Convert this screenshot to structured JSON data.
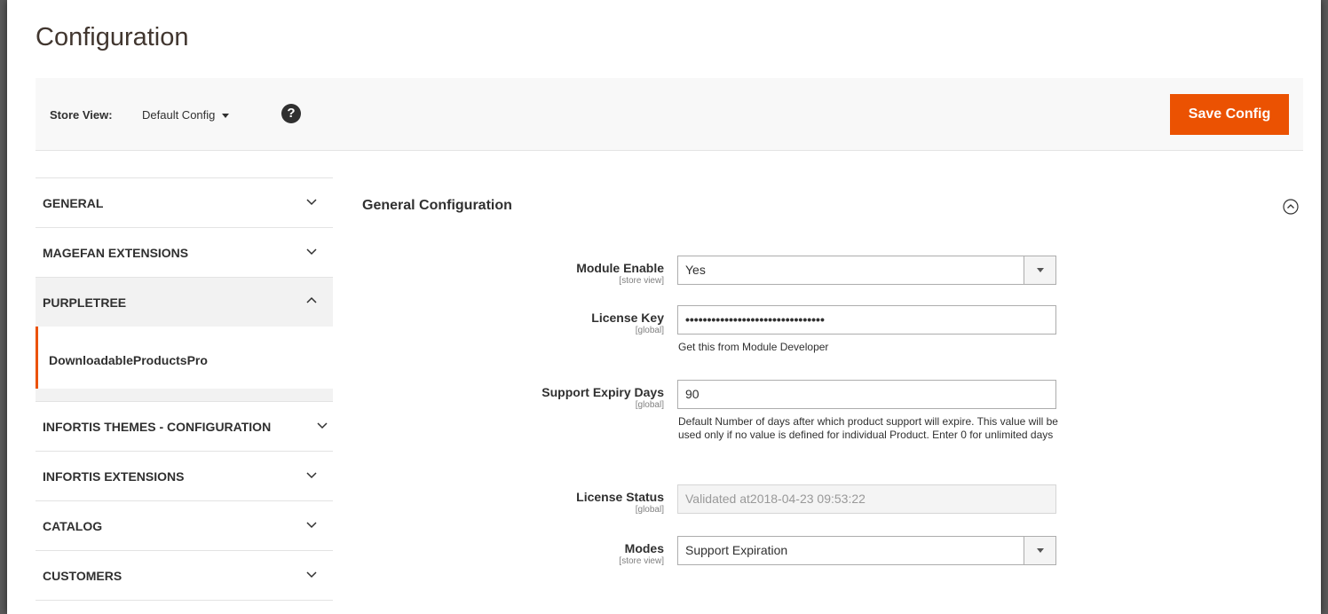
{
  "page": {
    "title": "Configuration"
  },
  "store_bar": {
    "label": "Store View:",
    "value": "Default Config",
    "help_glyph": "?",
    "save_label": "Save Config",
    "accent_color": "#eb5202"
  },
  "sidebar": {
    "tabs": [
      {
        "label": "GENERAL",
        "state": "collapsed",
        "icon": "chevron-down-icon"
      },
      {
        "label": "MAGEFAN EXTENSIONS",
        "state": "collapsed",
        "icon": "chevron-down-icon"
      },
      {
        "label": "PURPLETREE",
        "state": "expanded",
        "icon": "chevron-up-icon",
        "items": [
          {
            "label": "DownloadableProductsPro",
            "active": true
          }
        ]
      },
      {
        "label": "INFORTIS THEMES - CONFIGURATION",
        "state": "collapsed",
        "icon": "chevron-down-icon"
      },
      {
        "label": "INFORTIS EXTENSIONS",
        "state": "collapsed",
        "icon": "chevron-down-icon"
      },
      {
        "label": "CATALOG",
        "state": "collapsed",
        "icon": "chevron-down-icon"
      },
      {
        "label": "CUSTOMERS",
        "state": "collapsed",
        "icon": "chevron-down-icon"
      }
    ]
  },
  "section": {
    "title": "General Configuration",
    "collapse_icon": "collapse-circle-icon",
    "fields": {
      "module_enable": {
        "label": "Module Enable",
        "scope": "[store view]",
        "value": "Yes"
      },
      "license_key": {
        "label": "License Key",
        "scope": "[global]",
        "value": "••••••••••••••••••••••••••••••••",
        "note": "Get this from Module Developer"
      },
      "support_expiry": {
        "label": "Support Expiry Days",
        "scope": "[global]",
        "value": "90",
        "note": "Default Number of days after which product support will expire. This value will be used only if no value is defined for individual Product. Enter 0 for unlimited days"
      },
      "license_status": {
        "label": "License Status",
        "scope": "[global]",
        "value": "Validated at2018-04-23 09:53:22"
      },
      "modes": {
        "label": "Modes",
        "scope": "[store view]",
        "value": "Support Expiration"
      }
    }
  }
}
